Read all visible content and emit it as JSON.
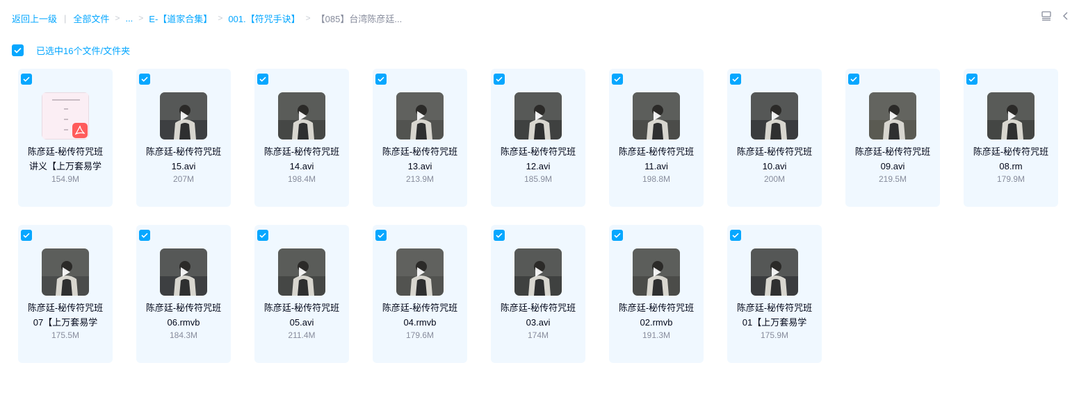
{
  "breadcrumb": {
    "back": "返回上一级",
    "items": [
      "全部文件",
      "...",
      "E-【道家合集】",
      "001.【符咒手诀】"
    ],
    "current": "【085】台湾陈彦廷..."
  },
  "selection": {
    "label": "已选中16个文件/文件夹"
  },
  "files": [
    {
      "line1": "陈彦廷-秘传符咒班",
      "line2": "讲义【上万套易学",
      "size": "154.9M",
      "type": "pdf"
    },
    {
      "line1": "陈彦廷-秘传符咒班",
      "line2": "15.avi",
      "size": "207M",
      "type": "video"
    },
    {
      "line1": "陈彦廷-秘传符咒班",
      "line2": "14.avi",
      "size": "198.4M",
      "type": "video"
    },
    {
      "line1": "陈彦廷-秘传符咒班",
      "line2": "13.avi",
      "size": "213.9M",
      "type": "video"
    },
    {
      "line1": "陈彦廷-秘传符咒班",
      "line2": "12.avi",
      "size": "185.9M",
      "type": "video"
    },
    {
      "line1": "陈彦廷-秘传符咒班",
      "line2": "11.avi",
      "size": "198.8M",
      "type": "video"
    },
    {
      "line1": "陈彦廷-秘传符咒班",
      "line2": "10.avi",
      "size": "200M",
      "type": "video"
    },
    {
      "line1": "陈彦廷-秘传符咒班",
      "line2": "09.avi",
      "size": "219.5M",
      "type": "video"
    },
    {
      "line1": "陈彦廷-秘传符咒班",
      "line2": "08.rm",
      "size": "179.9M",
      "type": "video"
    },
    {
      "line1": "陈彦廷-秘传符咒班",
      "line2": "07【上万套易学",
      "size": "175.5M",
      "type": "video"
    },
    {
      "line1": "陈彦廷-秘传符咒班",
      "line2": "06.rmvb",
      "size": "184.3M",
      "type": "video"
    },
    {
      "line1": "陈彦廷-秘传符咒班",
      "line2": "05.avi",
      "size": "211.4M",
      "type": "video"
    },
    {
      "line1": "陈彦廷-秘传符咒班",
      "line2": "04.rmvb",
      "size": "179.6M",
      "type": "video"
    },
    {
      "line1": "陈彦廷-秘传符咒班",
      "line2": "03.avi",
      "size": "174M",
      "type": "video"
    },
    {
      "line1": "陈彦廷-秘传符咒班",
      "line2": "02.rmvb",
      "size": "191.3M",
      "type": "video"
    },
    {
      "line1": "陈彦廷-秘传符咒班",
      "line2": "01【上万套易学",
      "size": "175.9M",
      "type": "video"
    }
  ],
  "icons": {
    "view_toggle": "list-view-icon",
    "collapse": "chevron-left-icon",
    "checkbox": "checkmark-icon",
    "play": "play-icon",
    "pdf": "pdf-icon"
  },
  "colors": {
    "accent": "#06a7ff",
    "card_bg": "#f0f8ff",
    "pdf_badge": "#ff5b5b",
    "muted_text": "#878c9c"
  }
}
